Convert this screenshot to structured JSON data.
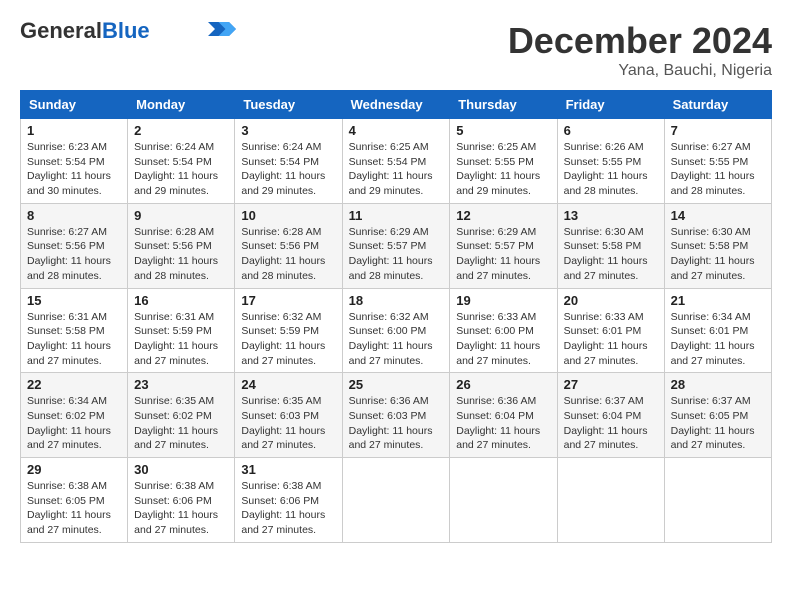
{
  "header": {
    "logo_general": "General",
    "logo_blue": "Blue",
    "month_title": "December 2024",
    "location": "Yana, Bauchi, Nigeria"
  },
  "days_of_week": [
    "Sunday",
    "Monday",
    "Tuesday",
    "Wednesday",
    "Thursday",
    "Friday",
    "Saturday"
  ],
  "weeks": [
    [
      {
        "day": "1",
        "info": "Sunrise: 6:23 AM\nSunset: 5:54 PM\nDaylight: 11 hours\nand 30 minutes."
      },
      {
        "day": "2",
        "info": "Sunrise: 6:24 AM\nSunset: 5:54 PM\nDaylight: 11 hours\nand 29 minutes."
      },
      {
        "day": "3",
        "info": "Sunrise: 6:24 AM\nSunset: 5:54 PM\nDaylight: 11 hours\nand 29 minutes."
      },
      {
        "day": "4",
        "info": "Sunrise: 6:25 AM\nSunset: 5:54 PM\nDaylight: 11 hours\nand 29 minutes."
      },
      {
        "day": "5",
        "info": "Sunrise: 6:25 AM\nSunset: 5:55 PM\nDaylight: 11 hours\nand 29 minutes."
      },
      {
        "day": "6",
        "info": "Sunrise: 6:26 AM\nSunset: 5:55 PM\nDaylight: 11 hours\nand 28 minutes."
      },
      {
        "day": "7",
        "info": "Sunrise: 6:27 AM\nSunset: 5:55 PM\nDaylight: 11 hours\nand 28 minutes."
      }
    ],
    [
      {
        "day": "8",
        "info": "Sunrise: 6:27 AM\nSunset: 5:56 PM\nDaylight: 11 hours\nand 28 minutes."
      },
      {
        "day": "9",
        "info": "Sunrise: 6:28 AM\nSunset: 5:56 PM\nDaylight: 11 hours\nand 28 minutes."
      },
      {
        "day": "10",
        "info": "Sunrise: 6:28 AM\nSunset: 5:56 PM\nDaylight: 11 hours\nand 28 minutes."
      },
      {
        "day": "11",
        "info": "Sunrise: 6:29 AM\nSunset: 5:57 PM\nDaylight: 11 hours\nand 28 minutes."
      },
      {
        "day": "12",
        "info": "Sunrise: 6:29 AM\nSunset: 5:57 PM\nDaylight: 11 hours\nand 27 minutes."
      },
      {
        "day": "13",
        "info": "Sunrise: 6:30 AM\nSunset: 5:58 PM\nDaylight: 11 hours\nand 27 minutes."
      },
      {
        "day": "14",
        "info": "Sunrise: 6:30 AM\nSunset: 5:58 PM\nDaylight: 11 hours\nand 27 minutes."
      }
    ],
    [
      {
        "day": "15",
        "info": "Sunrise: 6:31 AM\nSunset: 5:58 PM\nDaylight: 11 hours\nand 27 minutes."
      },
      {
        "day": "16",
        "info": "Sunrise: 6:31 AM\nSunset: 5:59 PM\nDaylight: 11 hours\nand 27 minutes."
      },
      {
        "day": "17",
        "info": "Sunrise: 6:32 AM\nSunset: 5:59 PM\nDaylight: 11 hours\nand 27 minutes."
      },
      {
        "day": "18",
        "info": "Sunrise: 6:32 AM\nSunset: 6:00 PM\nDaylight: 11 hours\nand 27 minutes."
      },
      {
        "day": "19",
        "info": "Sunrise: 6:33 AM\nSunset: 6:00 PM\nDaylight: 11 hours\nand 27 minutes."
      },
      {
        "day": "20",
        "info": "Sunrise: 6:33 AM\nSunset: 6:01 PM\nDaylight: 11 hours\nand 27 minutes."
      },
      {
        "day": "21",
        "info": "Sunrise: 6:34 AM\nSunset: 6:01 PM\nDaylight: 11 hours\nand 27 minutes."
      }
    ],
    [
      {
        "day": "22",
        "info": "Sunrise: 6:34 AM\nSunset: 6:02 PM\nDaylight: 11 hours\nand 27 minutes."
      },
      {
        "day": "23",
        "info": "Sunrise: 6:35 AM\nSunset: 6:02 PM\nDaylight: 11 hours\nand 27 minutes."
      },
      {
        "day": "24",
        "info": "Sunrise: 6:35 AM\nSunset: 6:03 PM\nDaylight: 11 hours\nand 27 minutes."
      },
      {
        "day": "25",
        "info": "Sunrise: 6:36 AM\nSunset: 6:03 PM\nDaylight: 11 hours\nand 27 minutes."
      },
      {
        "day": "26",
        "info": "Sunrise: 6:36 AM\nSunset: 6:04 PM\nDaylight: 11 hours\nand 27 minutes."
      },
      {
        "day": "27",
        "info": "Sunrise: 6:37 AM\nSunset: 6:04 PM\nDaylight: 11 hours\nand 27 minutes."
      },
      {
        "day": "28",
        "info": "Sunrise: 6:37 AM\nSunset: 6:05 PM\nDaylight: 11 hours\nand 27 minutes."
      }
    ],
    [
      {
        "day": "29",
        "info": "Sunrise: 6:38 AM\nSunset: 6:05 PM\nDaylight: 11 hours\nand 27 minutes."
      },
      {
        "day": "30",
        "info": "Sunrise: 6:38 AM\nSunset: 6:06 PM\nDaylight: 11 hours\nand 27 minutes."
      },
      {
        "day": "31",
        "info": "Sunrise: 6:38 AM\nSunset: 6:06 PM\nDaylight: 11 hours\nand 27 minutes."
      },
      null,
      null,
      null,
      null
    ]
  ]
}
